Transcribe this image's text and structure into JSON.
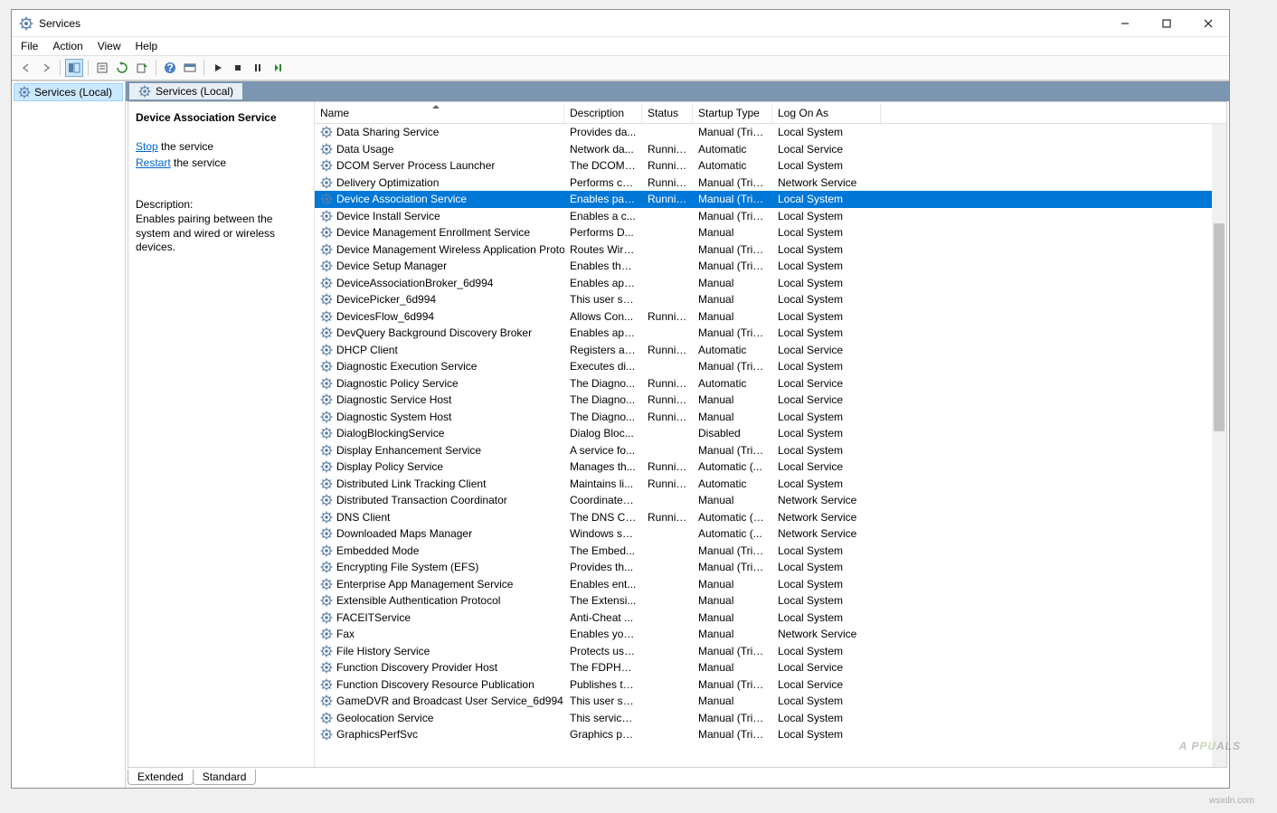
{
  "window": {
    "title": "Services"
  },
  "menubar": [
    "File",
    "Action",
    "View",
    "Help"
  ],
  "tree": {
    "root": "Services (Local)"
  },
  "tab_header": "Services (Local)",
  "detail": {
    "service_name": "Device Association Service",
    "action_stop_link": "Stop",
    "action_stop_suffix": " the service",
    "action_restart_link": "Restart",
    "action_restart_suffix": " the service",
    "desc_label": "Description:",
    "desc_text": "Enables pairing between the system and wired or wireless devices."
  },
  "columns": {
    "name": "Name",
    "desc": "Description",
    "status": "Status",
    "startup": "Startup Type",
    "logon": "Log On As"
  },
  "selected_index": 4,
  "services": [
    {
      "name": "Data Sharing Service",
      "desc": "Provides da...",
      "status": "",
      "startup": "Manual (Trig...",
      "logon": "Local System"
    },
    {
      "name": "Data Usage",
      "desc": "Network da...",
      "status": "Running",
      "startup": "Automatic",
      "logon": "Local Service"
    },
    {
      "name": "DCOM Server Process Launcher",
      "desc": "The DCOML...",
      "status": "Running",
      "startup": "Automatic",
      "logon": "Local System"
    },
    {
      "name": "Delivery Optimization",
      "desc": "Performs co...",
      "status": "Running",
      "startup": "Manual (Trig...",
      "logon": "Network Service"
    },
    {
      "name": "Device Association Service",
      "desc": "Enables pair...",
      "status": "Running",
      "startup": "Manual (Trig...",
      "logon": "Local System"
    },
    {
      "name": "Device Install Service",
      "desc": "Enables a c...",
      "status": "",
      "startup": "Manual (Trig...",
      "logon": "Local System"
    },
    {
      "name": "Device Management Enrollment Service",
      "desc": "Performs D...",
      "status": "",
      "startup": "Manual",
      "logon": "Local System"
    },
    {
      "name": "Device Management Wireless Application Proto...",
      "desc": "Routes Wire...",
      "status": "",
      "startup": "Manual (Trig...",
      "logon": "Local System"
    },
    {
      "name": "Device Setup Manager",
      "desc": "Enables the ...",
      "status": "",
      "startup": "Manual (Trig...",
      "logon": "Local System"
    },
    {
      "name": "DeviceAssociationBroker_6d994",
      "desc": "Enables app...",
      "status": "",
      "startup": "Manual",
      "logon": "Local System"
    },
    {
      "name": "DevicePicker_6d994",
      "desc": "This user ser...",
      "status": "",
      "startup": "Manual",
      "logon": "Local System"
    },
    {
      "name": "DevicesFlow_6d994",
      "desc": "Allows Con...",
      "status": "Running",
      "startup": "Manual",
      "logon": "Local System"
    },
    {
      "name": "DevQuery Background Discovery Broker",
      "desc": "Enables app...",
      "status": "",
      "startup": "Manual (Trig...",
      "logon": "Local System"
    },
    {
      "name": "DHCP Client",
      "desc": "Registers an...",
      "status": "Running",
      "startup": "Automatic",
      "logon": "Local Service"
    },
    {
      "name": "Diagnostic Execution Service",
      "desc": "Executes di...",
      "status": "",
      "startup": "Manual (Trig...",
      "logon": "Local System"
    },
    {
      "name": "Diagnostic Policy Service",
      "desc": "The Diagno...",
      "status": "Running",
      "startup": "Automatic",
      "logon": "Local Service"
    },
    {
      "name": "Diagnostic Service Host",
      "desc": "The Diagno...",
      "status": "Running",
      "startup": "Manual",
      "logon": "Local Service"
    },
    {
      "name": "Diagnostic System Host",
      "desc": "The Diagno...",
      "status": "Running",
      "startup": "Manual",
      "logon": "Local System"
    },
    {
      "name": "DialogBlockingService",
      "desc": "Dialog Bloc...",
      "status": "",
      "startup": "Disabled",
      "logon": "Local System"
    },
    {
      "name": "Display Enhancement Service",
      "desc": "A service fo...",
      "status": "",
      "startup": "Manual (Trig...",
      "logon": "Local System"
    },
    {
      "name": "Display Policy Service",
      "desc": "Manages th...",
      "status": "Running",
      "startup": "Automatic (...",
      "logon": "Local Service"
    },
    {
      "name": "Distributed Link Tracking Client",
      "desc": "Maintains li...",
      "status": "Running",
      "startup": "Automatic",
      "logon": "Local System"
    },
    {
      "name": "Distributed Transaction Coordinator",
      "desc": "Coordinates...",
      "status": "",
      "startup": "Manual",
      "logon": "Network Service"
    },
    {
      "name": "DNS Client",
      "desc": "The DNS Cli...",
      "status": "Running",
      "startup": "Automatic (T...",
      "logon": "Network Service"
    },
    {
      "name": "Downloaded Maps Manager",
      "desc": "Windows se...",
      "status": "",
      "startup": "Automatic (...",
      "logon": "Network Service"
    },
    {
      "name": "Embedded Mode",
      "desc": "The Embed...",
      "status": "",
      "startup": "Manual (Trig...",
      "logon": "Local System"
    },
    {
      "name": "Encrypting File System (EFS)",
      "desc": "Provides th...",
      "status": "",
      "startup": "Manual (Trig...",
      "logon": "Local System"
    },
    {
      "name": "Enterprise App Management Service",
      "desc": "Enables ent...",
      "status": "",
      "startup": "Manual",
      "logon": "Local System"
    },
    {
      "name": "Extensible Authentication Protocol",
      "desc": "The Extensi...",
      "status": "",
      "startup": "Manual",
      "logon": "Local System"
    },
    {
      "name": "FACEITService",
      "desc": "Anti-Cheat ...",
      "status": "",
      "startup": "Manual",
      "logon": "Local System"
    },
    {
      "name": "Fax",
      "desc": "Enables you...",
      "status": "",
      "startup": "Manual",
      "logon": "Network Service"
    },
    {
      "name": "File History Service",
      "desc": "Protects use...",
      "status": "",
      "startup": "Manual (Trig...",
      "logon": "Local System"
    },
    {
      "name": "Function Discovery Provider Host",
      "desc": "The FDPHO...",
      "status": "",
      "startup": "Manual",
      "logon": "Local Service"
    },
    {
      "name": "Function Discovery Resource Publication",
      "desc": "Publishes th...",
      "status": "",
      "startup": "Manual (Trig...",
      "logon": "Local Service"
    },
    {
      "name": "GameDVR and Broadcast User Service_6d994",
      "desc": "This user ser...",
      "status": "",
      "startup": "Manual",
      "logon": "Local System"
    },
    {
      "name": "Geolocation Service",
      "desc": "This service ...",
      "status": "",
      "startup": "Manual (Trig...",
      "logon": "Local System"
    },
    {
      "name": "GraphicsPerfSvc",
      "desc": "Graphics pe...",
      "status": "",
      "startup": "Manual (Trig...",
      "logon": "Local System"
    }
  ],
  "bottom_tabs": {
    "extended": "Extended",
    "standard": "Standard"
  },
  "watermark": {
    "pre": "A P",
    "highlight": "PU",
    "post": "ALS"
  },
  "source": "wsxdn.com"
}
